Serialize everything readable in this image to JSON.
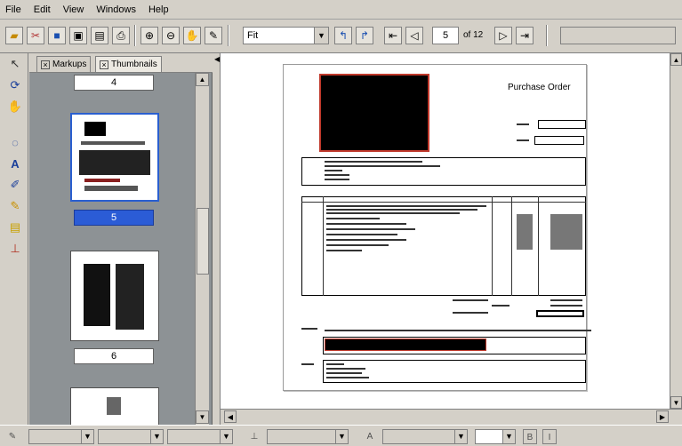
{
  "menu": [
    "File",
    "Edit",
    "View",
    "Windows",
    "Help"
  ],
  "toolbar": {
    "zoom_value": "Fit",
    "page_number": "5",
    "page_of": "of 12"
  },
  "panel": {
    "tabs": [
      "Markups",
      "Thumbnails"
    ],
    "pages": [
      {
        "label": "4"
      },
      {
        "label": "5",
        "selected": true
      },
      {
        "label": "6"
      }
    ]
  },
  "document": {
    "title": "Purchase Order"
  },
  "colors": {
    "selection": "#2b5cd6",
    "panel_bg": "#8d9295",
    "chrome": "#d4d0c8",
    "redaction_border": "#c0392b"
  }
}
